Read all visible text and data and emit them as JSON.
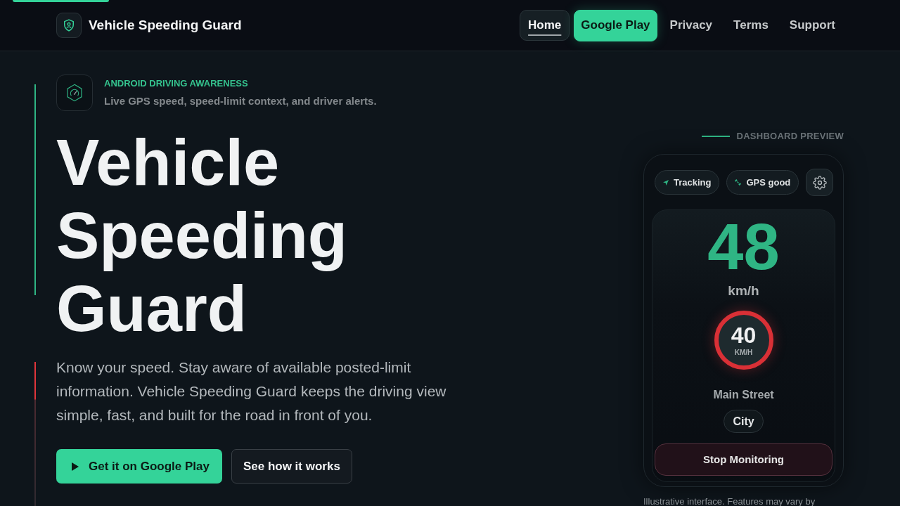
{
  "header": {
    "brand": "Vehicle Speeding Guard",
    "nav": [
      {
        "label": "Home",
        "kind": "link",
        "selected": true
      },
      {
        "label": "Google Play",
        "kind": "cta",
        "selected": false
      },
      {
        "label": "Privacy",
        "kind": "link",
        "selected": false
      },
      {
        "label": "Terms",
        "kind": "link",
        "selected": false
      },
      {
        "label": "Support",
        "kind": "link",
        "selected": false
      }
    ]
  },
  "hero": {
    "eyebrow": "ANDROID DRIVING AWARENESS",
    "tagline": "Live GPS speed, speed-limit context, and driver alerts.",
    "title": "Vehicle Speeding Guard",
    "description_lines": [
      "Know your speed. Stay aware of available posted-limit",
      "information. Vehicle Speeding Guard keeps the driving view",
      "simple, fast, and built for the road in front of you."
    ],
    "buttons": [
      {
        "label": "Get it on Google Play",
        "kind": "primary"
      },
      {
        "label": "See how it works",
        "kind": "secondary"
      }
    ]
  },
  "preview": {
    "label": "DASHBOARD PREVIEW",
    "chips": [
      {
        "label": "Tracking",
        "kind": "tracking"
      },
      {
        "label": "GPS good",
        "kind": "gps"
      }
    ],
    "speed": "48",
    "speed_unit": "km/h",
    "limit": "40",
    "limit_unit": "KM/H",
    "street": "Main Street",
    "area": "City",
    "action": "Stop Monitoring",
    "note": "Illustrative interface. Features may vary by"
  }
}
